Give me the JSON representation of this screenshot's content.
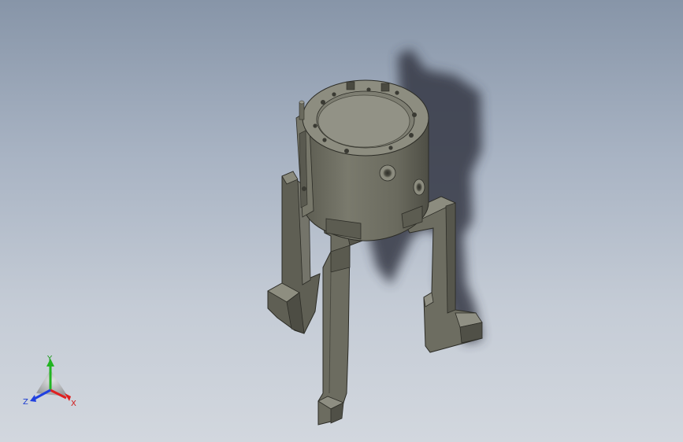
{
  "viewport": {
    "background_top": "#8795a8",
    "background_bottom": "#d2d7de",
    "model_color": "#6e6e62",
    "shadow_color": "#3a3f48"
  },
  "triad": {
    "y_label": "Y",
    "x_label": "X",
    "z_label": "Z",
    "y_color": "#22b422",
    "x_color": "#e02020",
    "z_color": "#2040e0"
  }
}
